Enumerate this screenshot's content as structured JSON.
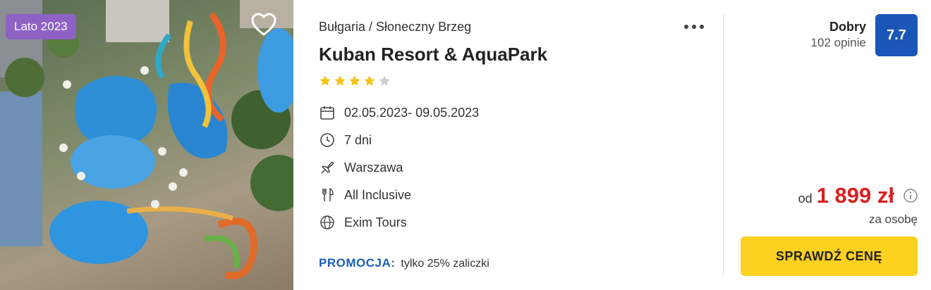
{
  "photo": {
    "alt_icon": "hotel-aerial-photo",
    "season_badge": "Lato 2023",
    "favorite_icon": "heart-icon"
  },
  "offer": {
    "location": "Bułgaria / Słoneczny Brzeg",
    "name": "Kuban Resort & AquaPark",
    "stars": 4,
    "stars_max": 5,
    "more_icon": "more-dots-icon",
    "details": [
      {
        "icon": "calendar-icon",
        "text": "02.05.2023- 09.05.2023"
      },
      {
        "icon": "clock-icon",
        "text": "7 dni"
      },
      {
        "icon": "plane-icon",
        "text": "Warszawa"
      },
      {
        "icon": "food-icon",
        "text": "All Inclusive"
      },
      {
        "icon": "globe-icon",
        "text": "Exim Tours"
      }
    ],
    "promo_label": "PROMOCJA:",
    "promo_text": "tylko 25% zaliczki"
  },
  "rating": {
    "word": "Dobry",
    "reviews": "102 opinie",
    "score": "7.7"
  },
  "price": {
    "prefix": "od",
    "value": "1 899 zł",
    "per_person": "za osobę",
    "cta_label": "SPRAWDŹ CENĘ"
  },
  "colors": {
    "accent_blue": "#1a56b8",
    "price_red": "#d92020",
    "cta_yellow": "#fcd120",
    "badge_purple": "#8e62c4",
    "star_gold": "#f5c518"
  }
}
